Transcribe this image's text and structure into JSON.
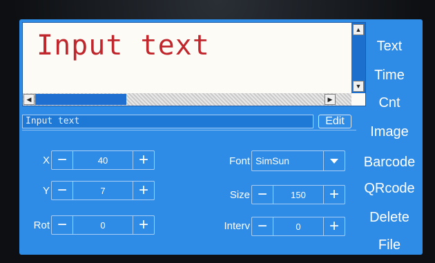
{
  "preview": {
    "text": "Input text",
    "text_color": "#c0272d"
  },
  "scrollbars": {
    "up_arrow": "▲",
    "down_arrow": "▼",
    "left_arrow": "◀",
    "right_arrow": "▶"
  },
  "text_input": {
    "value": "Input text",
    "edit_label": "Edit"
  },
  "params": {
    "x": {
      "label": "X",
      "value": "40",
      "minus": "−",
      "plus": "+"
    },
    "y": {
      "label": "Y",
      "value": "7",
      "minus": "−",
      "plus": "+"
    },
    "rot": {
      "label": "Rot",
      "value": "0",
      "minus": "−",
      "plus": "+"
    },
    "font": {
      "label": "Font",
      "value": "SimSun"
    },
    "size": {
      "label": "Size",
      "value": "150",
      "minus": "−",
      "plus": "+"
    },
    "interv": {
      "label": "Interv",
      "value": "0",
      "minus": "−",
      "plus": "+"
    }
  },
  "menu": {
    "items": [
      "Text",
      "Time",
      "Cnt",
      "Image",
      "Barcode",
      "QRcode",
      "Delete",
      "File"
    ]
  },
  "colors": {
    "screen": "#2f8ce6",
    "accent_text": "#c0272d"
  }
}
